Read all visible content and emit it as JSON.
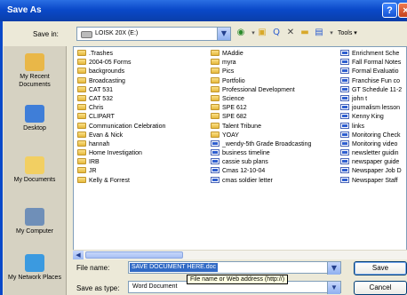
{
  "window": {
    "title": "Save As",
    "help_label": "?",
    "close_label": "×"
  },
  "save_in": {
    "label": "Save in:",
    "value": "LOISK 20X (E:)"
  },
  "toolbar": {
    "tools_label": "Tools ▾"
  },
  "places": [
    {
      "label": "My Recent Documents",
      "icon": "recent-documents-icon",
      "color": "#e9b748"
    },
    {
      "label": "Desktop",
      "icon": "desktop-icon",
      "color": "#3f7ed8"
    },
    {
      "label": "My Documents",
      "icon": "my-documents-icon",
      "color": "#f2cf62"
    },
    {
      "label": "My Computer",
      "icon": "my-computer-icon",
      "color": "#6f8fb8"
    },
    {
      "label": "My Network Places",
      "icon": "network-places-icon",
      "color": "#3b9ae0"
    }
  ],
  "files": {
    "col1": [
      {
        "name": ".Trashes",
        "type": "folder"
      },
      {
        "name": "2004-05 Forms",
        "type": "folder"
      },
      {
        "name": "backgrounds",
        "type": "folder"
      },
      {
        "name": "Broadcasting",
        "type": "folder"
      },
      {
        "name": "CAT 531",
        "type": "folder"
      },
      {
        "name": "CAT 532",
        "type": "folder"
      },
      {
        "name": "Chris",
        "type": "folder"
      },
      {
        "name": "CLIPART",
        "type": "folder"
      },
      {
        "name": "Communication Celebration",
        "type": "folder"
      },
      {
        "name": "Evan & Nick",
        "type": "folder"
      },
      {
        "name": "hannah",
        "type": "folder"
      },
      {
        "name": "Home Investigation",
        "type": "folder"
      },
      {
        "name": "IRB",
        "type": "folder"
      },
      {
        "name": "JR",
        "type": "folder"
      },
      {
        "name": "Kelly & Forrest",
        "type": "folder"
      }
    ],
    "col2": [
      {
        "name": "MAddie",
        "type": "folder"
      },
      {
        "name": "myra",
        "type": "folder"
      },
      {
        "name": "Pics",
        "type": "folder"
      },
      {
        "name": "Portfolio",
        "type": "folder"
      },
      {
        "name": "Professional Development",
        "type": "folder"
      },
      {
        "name": "Science",
        "type": "folder"
      },
      {
        "name": "SPE 612",
        "type": "folder"
      },
      {
        "name": "SPE 682",
        "type": "folder"
      },
      {
        "name": "Talent Tribune",
        "type": "folder"
      },
      {
        "name": "YOAY",
        "type": "folder"
      },
      {
        "name": "_wendy-5th Grade Broadcasting",
        "type": "doc"
      },
      {
        "name": "business timeline",
        "type": "doc"
      },
      {
        "name": "cassie sub plans",
        "type": "doc"
      },
      {
        "name": "Cmas 12-10-04",
        "type": "doc"
      },
      {
        "name": "cmas soldier letter",
        "type": "doc"
      }
    ],
    "col3": [
      {
        "name": "Enrichment Sche",
        "type": "doc"
      },
      {
        "name": "Fall Formal Notes",
        "type": "doc"
      },
      {
        "name": "Formal Evaluatio",
        "type": "doc"
      },
      {
        "name": "Franchise Fun co",
        "type": "doc"
      },
      {
        "name": "GT Schedule 11-2",
        "type": "doc"
      },
      {
        "name": "john t",
        "type": "doc"
      },
      {
        "name": "journalism lesson",
        "type": "doc"
      },
      {
        "name": "Kenny King",
        "type": "doc"
      },
      {
        "name": "links",
        "type": "doc"
      },
      {
        "name": "Monitoring Check",
        "type": "doc"
      },
      {
        "name": "Monitoring video",
        "type": "doc"
      },
      {
        "name": "newsletter guidin",
        "type": "doc"
      },
      {
        "name": "newspaper guide",
        "type": "doc"
      },
      {
        "name": "Newspaper Job D",
        "type": "doc"
      },
      {
        "name": "Newspaper Staff",
        "type": "doc"
      }
    ]
  },
  "file_name": {
    "label": "File name:",
    "value": "SAVE DOCUMENT HERE.doc"
  },
  "save_as_type": {
    "label": "Save as type:",
    "value": "Word Document"
  },
  "tooltip": "File name or Web address (http://)",
  "buttons": {
    "save": "Save",
    "cancel": "Cancel"
  }
}
